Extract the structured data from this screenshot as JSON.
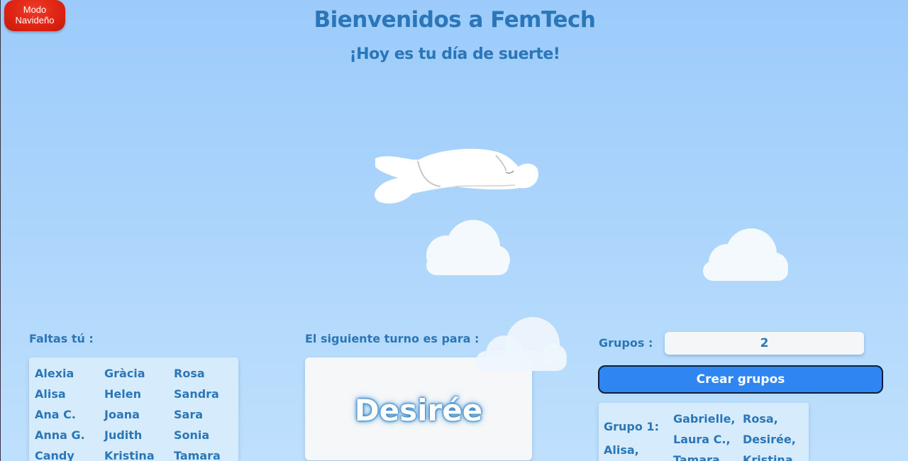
{
  "mode_button": {
    "line1": "Modo",
    "line2": "Navideño",
    "color": "#e0261a"
  },
  "header": {
    "title": "Bienvenidos a FemTech",
    "subtitle": "¡Hoy es tu día de suerte!"
  },
  "missing": {
    "label": "Faltas tú :",
    "names": [
      "Alexia",
      "Gràcia",
      "Rosa",
      "Alisa",
      "Helen",
      "Sandra",
      "Ana C.",
      "Joana",
      "Sara",
      "Anna G.",
      "Judith",
      "Sonia",
      "Candy",
      "Kristina",
      "Tamara"
    ]
  },
  "turn": {
    "label": "El siguiente turno es para :",
    "name": "Desirée"
  },
  "groups": {
    "label": "Grupos :",
    "value": "2",
    "create_button": "Crear grupos",
    "group1_label": "Grupo 1:",
    "col1": [
      "Alisa,"
    ],
    "col2": [
      "Gabrielle,",
      "Laura C.,",
      "Tamara,"
    ],
    "col3": [
      "Rosa,",
      "Desirée,",
      "Kristina,"
    ]
  },
  "colors": {
    "accent": "#2a76b8",
    "button": "#2f86f3",
    "sky": "#a9d3fb"
  }
}
